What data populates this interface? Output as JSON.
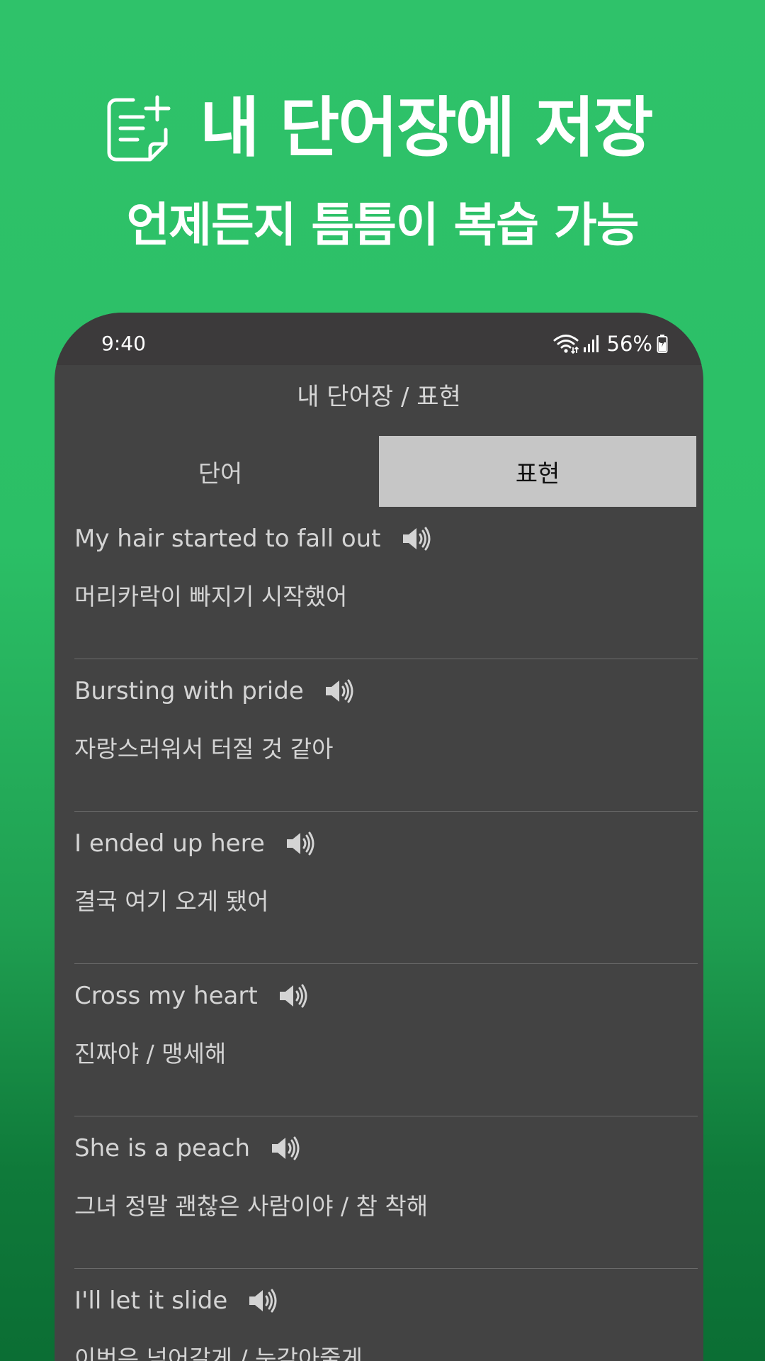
{
  "promo": {
    "title": "내 단어장에 저장",
    "subtitle": "언제든지 틈틈이 복습 가능",
    "icon": "add-note-icon"
  },
  "status_bar": {
    "time": "9:40",
    "battery": "56%",
    "icons": [
      "wifi-icon",
      "signal-icon",
      "battery-charging-icon"
    ]
  },
  "app": {
    "title": "내 단어장 / 표현"
  },
  "tabs": [
    {
      "label": "단어",
      "active": false
    },
    {
      "label": "표현",
      "active": true
    }
  ],
  "expressions": [
    {
      "en": "My hair started to fall out",
      "ko": "머리카락이 빠지기 시작했어"
    },
    {
      "en": "Bursting with pride",
      "ko": "자랑스러워서 터질 것 같아"
    },
    {
      "en": "I ended up here",
      "ko": "결국 여기 오게 됐어"
    },
    {
      "en": "Cross my heart",
      "ko": "진짜야 / 맹세해"
    },
    {
      "en": "She is a peach",
      "ko": "그녀 정말 괜찮은 사람이야 / 참 착해"
    },
    {
      "en": "I'll let it slide",
      "ko": "이번은 넘어갈게 / 눈감아줄게"
    }
  ],
  "colors": {
    "accent_green": "#2bbf66",
    "phone_bg": "#434343",
    "active_tab_bg": "#c6c6c6"
  }
}
